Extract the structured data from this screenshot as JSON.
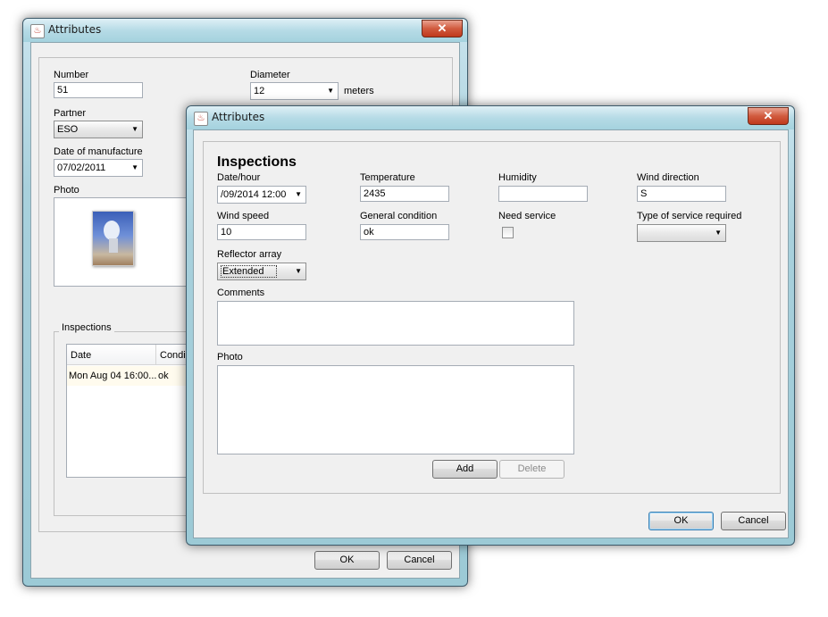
{
  "back_window": {
    "title": "Attributes",
    "close_glyph": "✕",
    "number_label": "Number",
    "number_value": "51",
    "diameter_label": "Diameter",
    "diameter_value": "12",
    "diameter_unit": "meters",
    "partner_label": "Partner",
    "partner_value": "ESO",
    "manufacture_label": "Date of manufacture",
    "manufacture_value": "07/02/2011",
    "photo_label": "Photo",
    "inspections_label": "Inspections",
    "table": {
      "columns": [
        "Date",
        "Condi"
      ],
      "rows": [
        [
          "Mon Aug 04 16:00...",
          "ok"
        ]
      ]
    },
    "ok_label": "OK",
    "cancel_label": "Cancel"
  },
  "front_window": {
    "title": "Attributes",
    "close_glyph": "✕",
    "heading": "Inspections",
    "date_label": "Date/hour",
    "date_value": "/09/2014 12:00",
    "temperature_label": "Temperature",
    "temperature_value": "2435",
    "humidity_label": "Humidity",
    "humidity_value": "",
    "wind_direction_label": "Wind direction",
    "wind_direction_value": "S",
    "wind_speed_label": "Wind speed",
    "wind_speed_value": "10",
    "general_condition_label": "General condition",
    "general_condition_value": "ok",
    "need_service_label": "Need service",
    "need_service_checked": false,
    "service_type_label": "Type of service required",
    "service_type_value": "",
    "reflector_label": "Reflector array",
    "reflector_value": "Extended",
    "comments_label": "Comments",
    "photo_label": "Photo",
    "add_label": "Add",
    "delete_label": "Delete",
    "ok_label": "OK",
    "cancel_label": "Cancel"
  },
  "icons": {
    "java": "java-icon",
    "close": "close-icon",
    "dropdown": "chevron-down-icon",
    "photo": "antenna-photo"
  }
}
